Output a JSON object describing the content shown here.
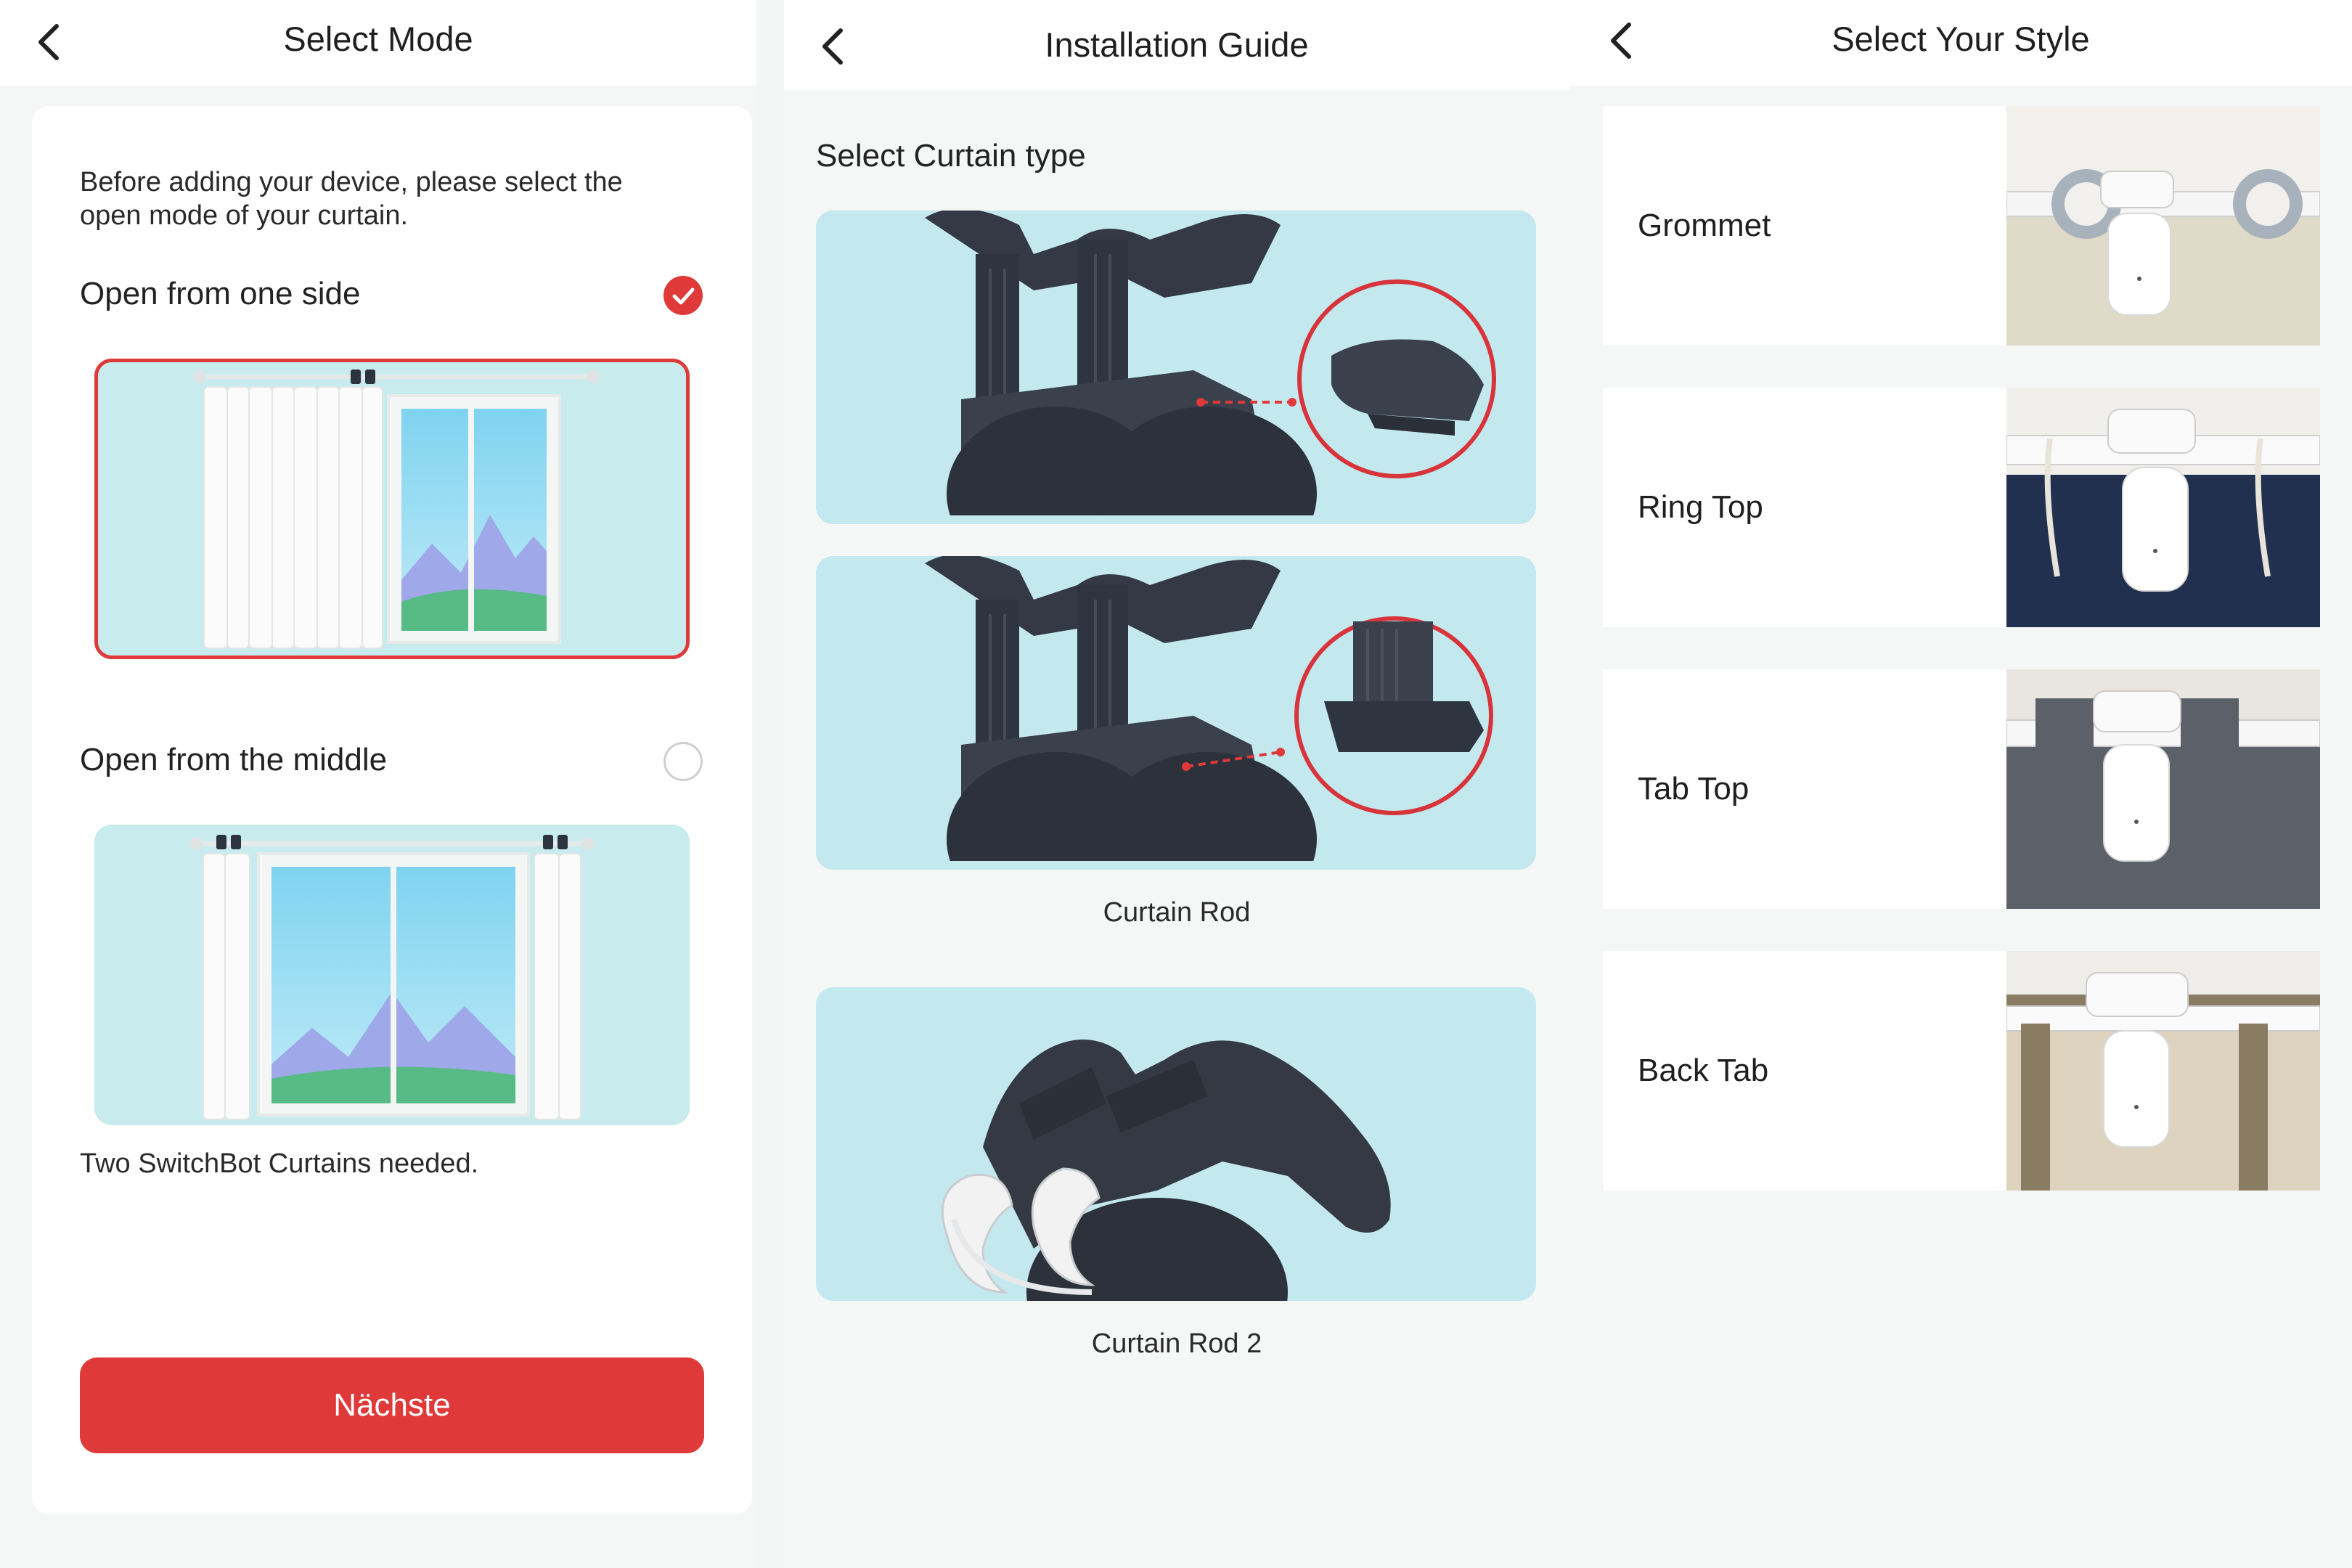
{
  "select_mode": {
    "title": "Select Mode",
    "intro_line1": "Before adding your device, please select the",
    "intro_line2": "open mode of your curtain.",
    "option_one_side": {
      "label": "Open from one side",
      "selected": true
    },
    "option_middle": {
      "label": "Open from the middle",
      "selected": false
    },
    "note": "Two SwitchBot Curtains needed.",
    "next_button": "Nächste",
    "accent_color": "#e03939"
  },
  "installation_guide": {
    "title": "Installation Guide",
    "section_title": "Select Curtain type",
    "captions": [
      "Curtain Rod",
      "Curtain Rod 2"
    ]
  },
  "select_style": {
    "title": "Select Your Style",
    "styles": [
      {
        "label": "Grommet"
      },
      {
        "label": "Ring Top"
      },
      {
        "label": "Tab Top"
      },
      {
        "label": "Back Tab"
      }
    ]
  }
}
